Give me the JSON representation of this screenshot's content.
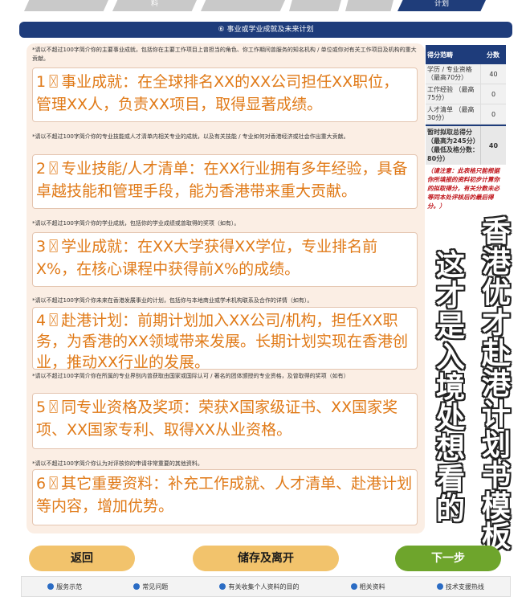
{
  "steps": [
    "",
    "料",
    "",
    "",
    "",
    "",
    "计划"
  ],
  "section": {
    "title": "⑥ 事业或学业成就及未来计划"
  },
  "fields": [
    {
      "label": "*请以不超过100字简介你的主要事业成就，包括你在主要工作项目上曾担当的角色、你工作期间曾服务的知名机构 / 单位或你对有关工作项目及机构的重大贡献。",
      "value": "1〿事业成就：在全球排名XX的XX公司担任XX职位，管理XX人，负责XX项目，取得显著成绩。"
    },
    {
      "label": "*请以不超过100字简介你的专业技能或人才清单内相关专业的成就，以及有关技能 / 专业如何对香港经济或社会作出重大贡献。",
      "value": "2〿专业技能/人才清单：在XX行业拥有多年经验，具备卓越技能和管理手段，能为香港带来重大贡献。"
    },
    {
      "label": "*请以不超过100字简介你的学业成就，包括你的学业成绩或曾取得的奖项（如有）。",
      "value": "3〿学业成就：在XX大学获得XX学位，专业排名前X%，在核心课程中获得前X%的成绩。"
    },
    {
      "label": "*请以不超过100字简介你未来在香港发展事业的计划，包括你与本地商业或学术机构联系及合作的详情（如有）。",
      "value": "4〿赴港计划：前期计划加入XX公司/机构，担任XX职务，为香港的XX领域带来发展。长期计划实现在香港创业，推动XX行业的发展。"
    },
    {
      "label": "*请以不超过100字简介你在所属的专业界别内曾获取由国家或国际认可 / 著名的团体颁授的专业资格，及曾取得的奖项（如有）",
      "value": "5〿同专业资格及奖项：荣获X国家级证书、XX国家奖项、XX国家专利、取得XX从业资格。"
    },
    {
      "label": "*请以不超过100字简介你认为对评核你的申请非常重要的其他资料。",
      "value": "6〿其它重要资料：补充工作成就、人才清单、赴港计划等内容，增加优势。"
    }
  ],
  "score": {
    "col1": "得分范畴",
    "col2": "分数",
    "rows": [
      {
        "label": "学历 / 专业资格 （最高70分）",
        "value": "40"
      },
      {
        "label": "工作经验 （最高75分）",
        "value": "0"
      },
      {
        "label": "人才清单 （最高30分）",
        "value": "0"
      }
    ],
    "total_label": "暂时拟取总得分 （最高为245分） （最低及格分数：80分）",
    "total_value": "40",
    "note": "（请注意：此表格只能根据你所填报的资料初步计算你的拟取得分，有关分数未必等同本处评核后的最后得分。）"
  },
  "overlay": {
    "line1": [
      "这",
      "才",
      "是",
      "入",
      "境",
      "处",
      "想",
      "看",
      "的"
    ],
    "line2": [
      "香",
      "港",
      "优",
      "才",
      "赴",
      "港",
      "计",
      "划",
      "书",
      "模",
      "板"
    ]
  },
  "buttons": {
    "back": "返回",
    "save": "储存及离开",
    "next": "下一步"
  },
  "footer": [
    "服务示范",
    "常见问题",
    "有关收集个人资料的目的",
    "相关资料",
    "技术支援热线"
  ]
}
